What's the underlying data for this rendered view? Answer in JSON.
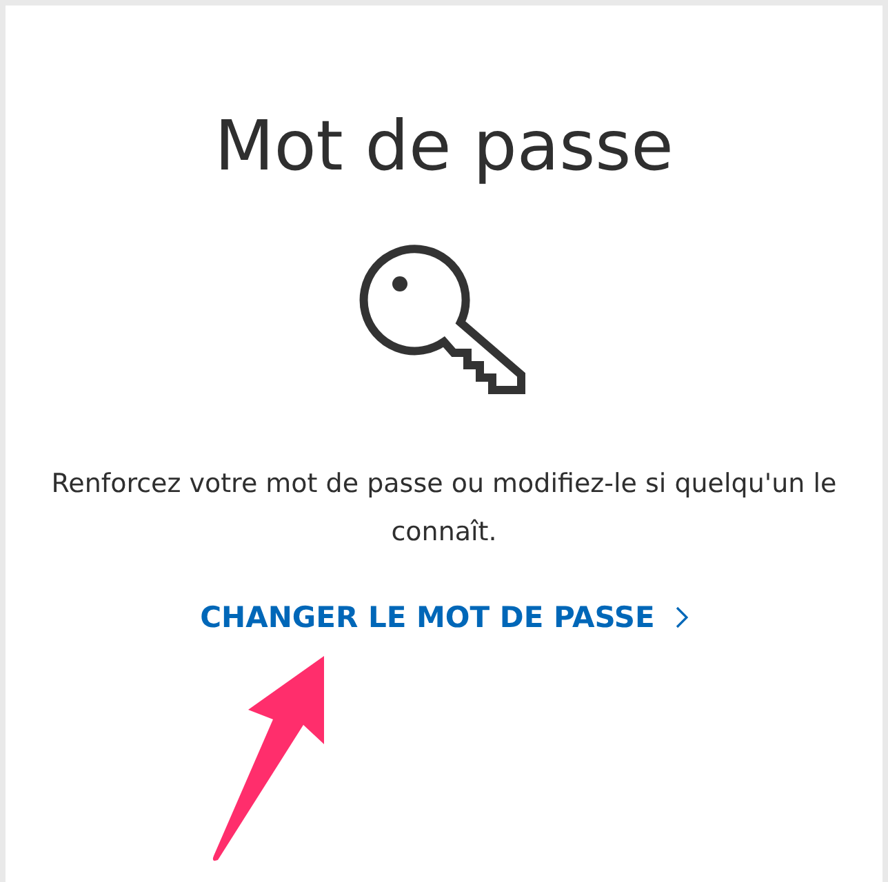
{
  "card": {
    "title": "Mot de passe",
    "description": "Renforcez votre mot de passe ou modifiez-le si quelqu'un le connaît.",
    "link": {
      "label": "CHANGER LE MOT DE PASSE"
    }
  }
}
